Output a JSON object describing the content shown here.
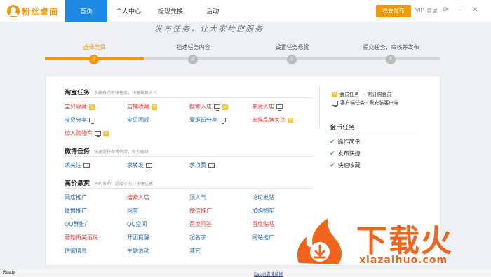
{
  "app": {
    "name": "粉丝桌面"
  },
  "nav": {
    "items": [
      "首页",
      "个人中心",
      "提现兑换",
      "活动"
    ]
  },
  "top": {
    "publish_label": "我要发布",
    "vip": "VIP",
    "login": "登录"
  },
  "slogan": "发布任务，让大家给您服务",
  "steps": [
    {
      "label": "选择类目",
      "num": "1"
    },
    {
      "label": "描述任务内容",
      "num": "2"
    },
    {
      "label": "设置任务悬赏",
      "num": "3"
    },
    {
      "label": "提交任务，审核并发布",
      "num": "4"
    }
  ],
  "sections": {
    "taobao": {
      "title": "淘宝任务",
      "subtitle": "系统自动审核任务，快速聚集人气"
    },
    "weibo": {
      "title": "微博任务",
      "subtitle": "快速提升微博热度，吸引眼球"
    },
    "premium": {
      "title": "高价悬赏",
      "subtitle": "钻石发布，超级引力，快速达成"
    }
  },
  "taobao_items": [
    "宝贝收藏",
    "店铺收藏",
    "搜索入店",
    "来源入店",
    "宝贝分享",
    "宝贝围观",
    "爱逛街分享",
    "天猫品牌关注",
    "加入购物车"
  ],
  "weibo_items": [
    "求关注",
    "求转发",
    "求点赞"
  ],
  "premium_items": [
    "网店推广",
    "搜索入店",
    "顶人气",
    "论坛发帖",
    "微博推广",
    "问答",
    "微信推广",
    "加购物车",
    "QQ群推广",
    "QQ空间",
    "百度问答",
    "百度贴吧",
    "蘑菇街美丽说",
    "开团提醒",
    "起名字",
    "网站推广",
    "供需信息",
    "主题活动",
    "其它"
  ],
  "legend": {
    "member": "会员任务　- 需订购会员",
    "client": "客户端任务 - 需安装客户端"
  },
  "coin": {
    "title": "金币任务",
    "items": [
      "操作简单",
      "发布快捷",
      "快速收藏"
    ]
  },
  "status": {
    "text": "Ready",
    "link": "Bao60店铺装修"
  },
  "watermark": {
    "big": "下载火",
    "small": "xiazaihuo.com"
  },
  "colors": {
    "accent": "#f39800",
    "nav_active": "#1e88e5",
    "link_blue": "#2b72b8",
    "link_red": "#e53935",
    "watermark": "#f0641e"
  }
}
